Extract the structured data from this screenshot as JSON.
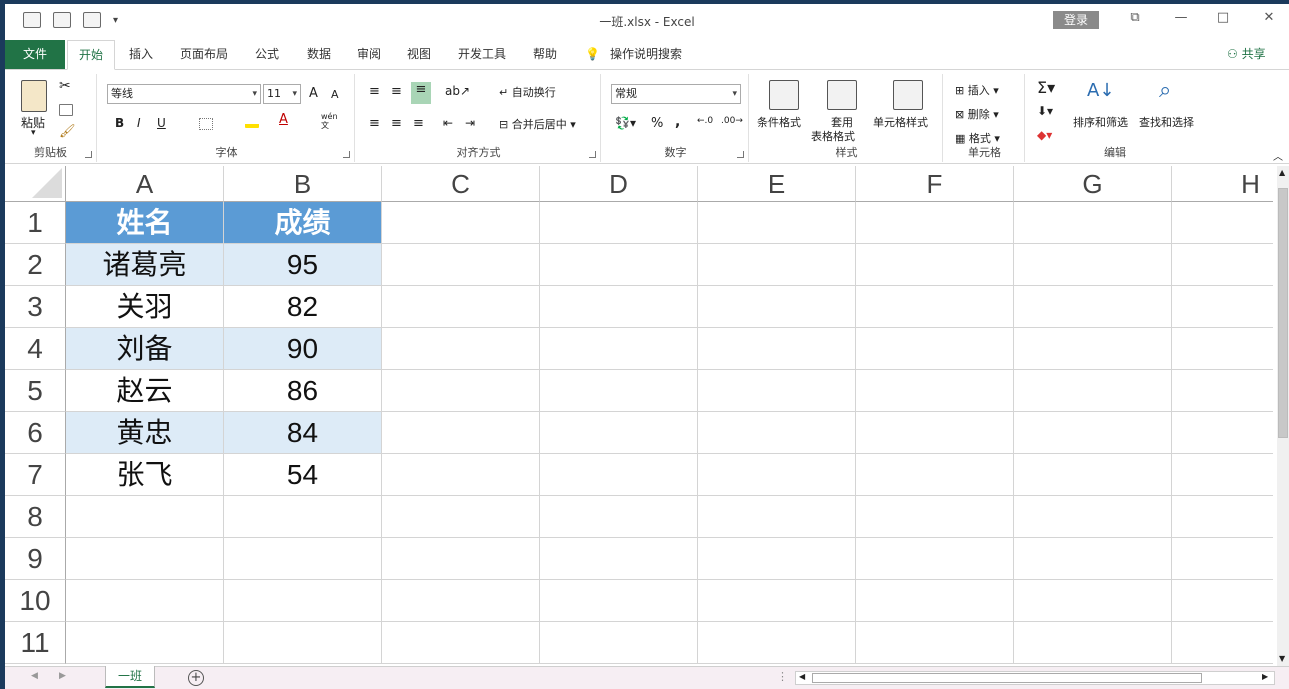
{
  "title_bar": {
    "doc_title": "一班.xlsx  -  Excel",
    "login": "登录",
    "restore_glyph": "⧉",
    "minimize_glyph": "—",
    "maximize_glyph": "□",
    "close_glyph": "✕"
  },
  "tabs": {
    "file": "文件",
    "items": [
      "开始",
      "插入",
      "页面布局",
      "公式",
      "数据",
      "审阅",
      "视图",
      "开发工具",
      "帮助"
    ],
    "tell_me": "操作说明搜索",
    "share": "共享"
  },
  "ribbon": {
    "clipboard": {
      "label": "剪贴板",
      "paste": "粘贴"
    },
    "font": {
      "label": "字体",
      "font_name": "等线",
      "font_size": "11",
      "bold": "B",
      "italic": "I",
      "underline": "U",
      "grow": "A",
      "shrink": "A",
      "wen": "wén\n文"
    },
    "alignment": {
      "label": "对齐方式",
      "wrap": "自动换行",
      "merge": "合并后居中"
    },
    "number": {
      "label": "数字",
      "format": "常规",
      "percent": "%",
      "comma": ","
    },
    "styles": {
      "label": "样式",
      "conditional": "条件格式",
      "table_a": "套用",
      "table_b": "表格格式",
      "cell_style": "单元格样式"
    },
    "cells": {
      "label": "单元格",
      "insert": "插入",
      "delete": "删除",
      "format": "格式"
    },
    "editing": {
      "label": "编辑",
      "sort": "排序和筛选",
      "find": "查找和选择"
    }
  },
  "grid": {
    "columns": [
      "A",
      "B",
      "C",
      "D",
      "E",
      "F",
      "G",
      "H"
    ],
    "row_numbers": [
      "1",
      "2",
      "3",
      "4",
      "5",
      "6",
      "7",
      "8",
      "9",
      "10",
      "11"
    ],
    "header": [
      "姓名",
      "成绩"
    ],
    "rows": [
      [
        "诸葛亮",
        "95"
      ],
      [
        "关羽",
        "82"
      ],
      [
        "刘备",
        "90"
      ],
      [
        "赵云",
        "86"
      ],
      [
        "黄忠",
        "84"
      ],
      [
        "张飞",
        "54"
      ]
    ]
  },
  "sheets": {
    "active": "一班",
    "add": "+"
  },
  "colors": {
    "accent": "#217346",
    "header_fill": "#5b9bd5",
    "band_fill": "#ddebf7"
  }
}
